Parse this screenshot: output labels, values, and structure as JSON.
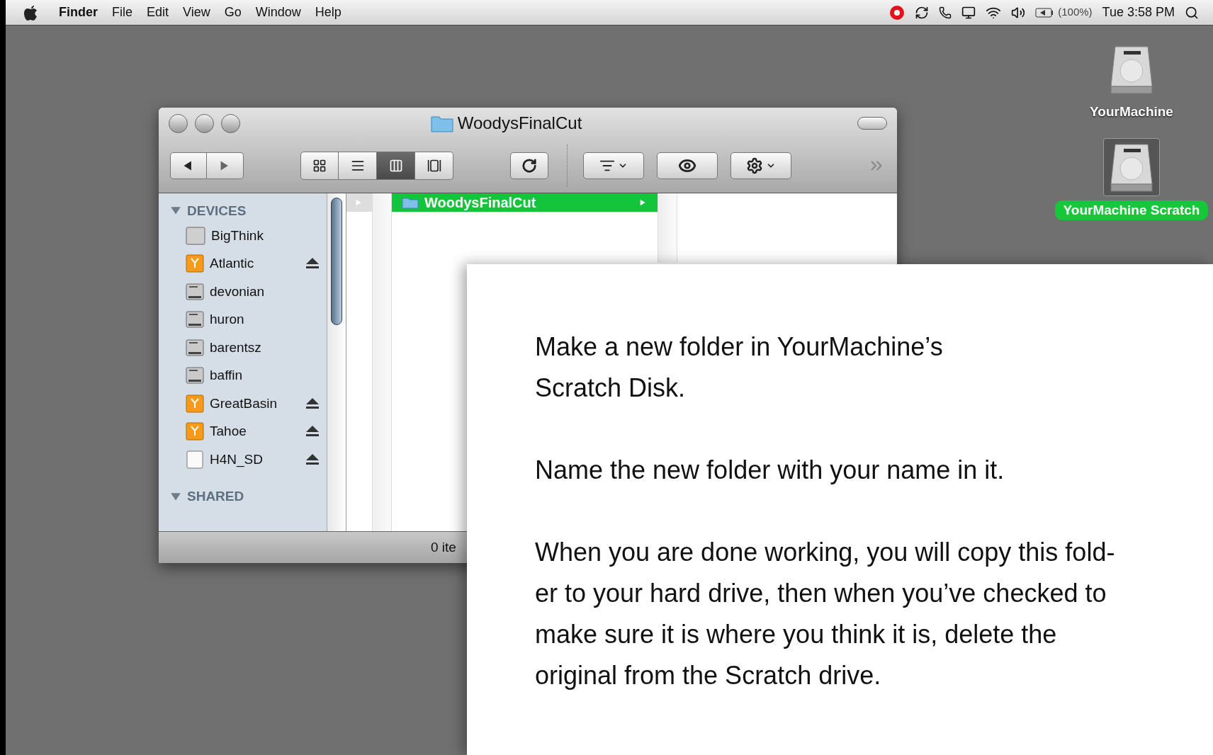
{
  "menu_bar": {
    "app_name": "Finder",
    "menus": [
      "File",
      "Edit",
      "View",
      "Go",
      "Window",
      "Help"
    ],
    "battery": "(100%)",
    "clock": "Tue 3:58 PM"
  },
  "desktop_icons": [
    {
      "label": "YourMachine",
      "selected": false
    },
    {
      "label": "YourMachine Scratch",
      "selected": true
    }
  ],
  "finder_window": {
    "title": "WoodysFinalCut",
    "view_modes": [
      {
        "kind": "icon",
        "selected": false
      },
      {
        "kind": "list",
        "selected": false
      },
      {
        "kind": "column",
        "selected": true
      },
      {
        "kind": "coverflow",
        "selected": false
      }
    ],
    "sidebar": [
      {
        "title": "DEVICES",
        "expanded": true,
        "items": [
          {
            "label": "BigThink",
            "kind": "computer",
            "ejectable": false
          },
          {
            "label": "Atlantic",
            "kind": "external",
            "ejectable": true
          },
          {
            "label": "devonian",
            "kind": "disk",
            "ejectable": false
          },
          {
            "label": "huron",
            "kind": "disk",
            "ejectable": false
          },
          {
            "label": "barentsz",
            "kind": "disk",
            "ejectable": false
          },
          {
            "label": "baffin",
            "kind": "disk",
            "ejectable": false
          },
          {
            "label": "GreatBasin",
            "kind": "external",
            "ejectable": true
          },
          {
            "label": "Tahoe",
            "kind": "external",
            "ejectable": true
          },
          {
            "label": "H4N_SD",
            "kind": "card",
            "ejectable": true
          }
        ]
      },
      {
        "title": "SHARED",
        "expanded": true
      }
    ],
    "column_items": [
      {
        "label": "WoodysFinalCut",
        "selected": true
      }
    ],
    "status": "0 ite"
  },
  "instructions": [
    {
      "lines": [
        "Make a new folder in YourMachine’s",
        "Scratch Disk."
      ]
    },
    {
      "lines": [
        "Name the new folder with your name in it."
      ]
    },
    {
      "lines": [
        "When you are done working, you will copy this fold-",
        "er to your hard drive, then when you’ve checked to",
        "make sure it is where you think it is, delete the",
        "original from the Scratch drive."
      ]
    }
  ]
}
